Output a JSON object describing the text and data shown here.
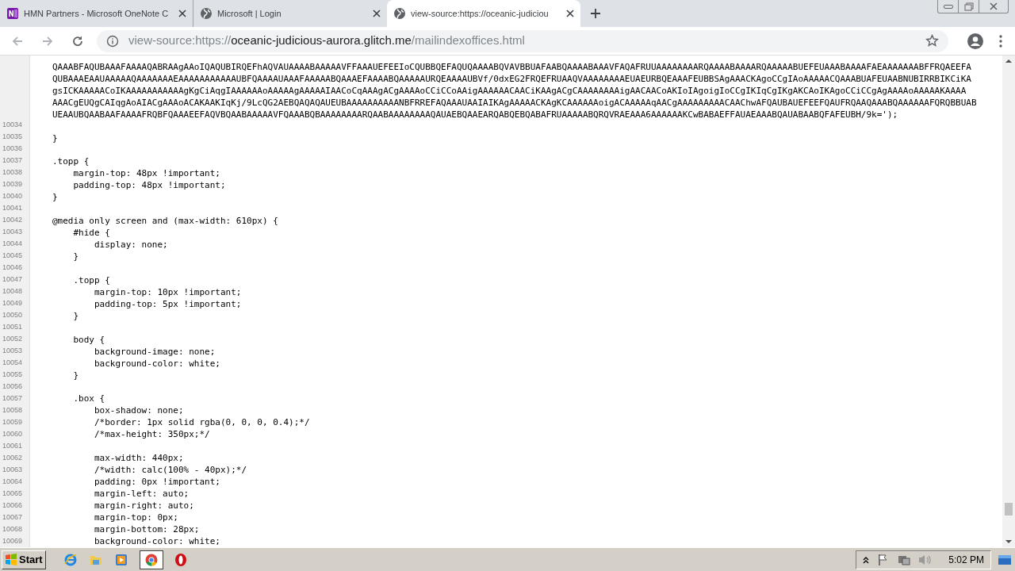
{
  "tabs": [
    {
      "title": "HMN Partners - Microsoft OneNote C",
      "kind": "onenote",
      "selected": false
    },
    {
      "title": "Microsoft | Login",
      "kind": "globe",
      "selected": false
    },
    {
      "title": "view-source:https://oceanic-judiciou",
      "kind": "globe",
      "selected": true
    }
  ],
  "address_bar": {
    "prefix": "view-source:https://",
    "host": "oceanic-judicious-aurora.glitch.me",
    "path": "/mailindexoffices.html"
  },
  "source": {
    "wrapped_lines": [
      "QAAABFAQUBAAAFAAAAQABRAAgAAoIQAQUBIRQEFhAQVAUAAAABAAAAAVFFAAAUEFEEIoCQUBBQEFAQUQAAAABQVAVBBUAFAABQAAAABAAAVFAQAFRUUAAAAAAAARQAAAABAAAARQAAAAABUEFEUAAABAAAAFAEAAAAAAABFFRQAEEFA",
      "QUBAAAEAAUAAAAAQAAAAAAAEAAAAAAAAAAAUBFQAAAAUAAAFAAAAABQAAAEFAAAABQAAAAAURQEAAAAUBVf/0dxEG2FRQEFRUAAQVAAAAAAAAEUAEURBQEAAAFEUBBSAgAAACKAgoCCgIAoAAAAACQAAABUAFEUAABNUBIRRBIKCiKA",
      "gsICKAAAAACoIKAAAAAAAAAAAgKgCiAqgIAAAAAAoAAAAAgAAAAAIAACoCqAAAgACgAAAAoCCiCCoAAigAAAAAACAACiKAAgACgCAAAAAAAAigAACAACoAKIoIAgoigIoCCgIKIqCgIKgAKCAoIKAgoCCiCCgAgAAAAoAAAAAKAAAA",
      "AAACgEUQgCAIqgAoAIACgAAAoACAKAAKIqKj/9LcQG2AEBQAQAQAUEUBAAAAAAAAAANBFRREFAQAAAUAAIAIKAgAAAAACKAgKCAAAAAAoigACAAAAAqAACgAAAAAAAAACAAChwAFQAUBAUEFEEFQAUFRQAAQAAABQAAAAAAFQRQBBUAB",
      "UEAAUBQAABAAFAAAAFRQBFQAAAEEFAQVBQAABAAAAAVFQAAABQBAAAAAAAARQAABAAAAAAAAQAUAEBQAAEARQABQEBQABAFRUAAAAABQRQVRAEAAA6AAAAAAKCwBABAEFFAUAEAAABQAUABAABQFAFEUBH/9k=');"
    ],
    "lines": [
      {
        "number": "10034"
      },
      {
        "number": "10035",
        "text": "}"
      },
      {
        "number": "10036"
      },
      {
        "number": "10037",
        "text": ".topp {"
      },
      {
        "number": "10038",
        "text": "    margin-top: 48px !important;"
      },
      {
        "number": "10039",
        "text": "    padding-top: 48px !important;"
      },
      {
        "number": "10040",
        "text": "}"
      },
      {
        "number": "10041"
      },
      {
        "number": "10042",
        "text": "@media only screen and (max-width: 610px) {"
      },
      {
        "number": "10043",
        "text": "    #hide {"
      },
      {
        "number": "10044",
        "text": "        display: none;"
      },
      {
        "number": "10045",
        "text": "    }"
      },
      {
        "number": "10046"
      },
      {
        "number": "10047",
        "text": "    .topp {"
      },
      {
        "number": "10048",
        "text": "        margin-top: 10px !important;"
      },
      {
        "number": "10049",
        "text": "        padding-top: 5px !important;"
      },
      {
        "number": "10050",
        "text": "    }"
      },
      {
        "number": "10051"
      },
      {
        "number": "10052",
        "text": "    body {"
      },
      {
        "number": "10053",
        "text": "        background-image: none;"
      },
      {
        "number": "10054",
        "text": "        background-color: white;"
      },
      {
        "number": "10055",
        "text": "    }"
      },
      {
        "number": "10056"
      },
      {
        "number": "10057",
        "text": "    .box {"
      },
      {
        "number": "10058",
        "text": "        box-shadow: none;"
      },
      {
        "number": "10059",
        "text": "        /*border: 1px solid rgba(0, 0, 0, 0.4);*/"
      },
      {
        "number": "10060",
        "text": "        /*max-height: 350px;*/"
      },
      {
        "number": "10061"
      },
      {
        "number": "10062",
        "text": "        max-width: 440px;"
      },
      {
        "number": "10063",
        "text": "        /*width: calc(100% - 40px);*/"
      },
      {
        "number": "10064",
        "text": "        padding: 0px !important;"
      },
      {
        "number": "10065",
        "text": "        margin-left: auto;"
      },
      {
        "number": "10066",
        "text": "        margin-right: auto;"
      },
      {
        "number": "10067",
        "text": "        margin-top: 0px;"
      },
      {
        "number": "10068",
        "text": "        margin-bottom: 28px;"
      },
      {
        "number": "10069",
        "text": "        background-color: white;"
      }
    ]
  },
  "taskbar": {
    "start": "Start",
    "clock": "5:02 PM"
  }
}
